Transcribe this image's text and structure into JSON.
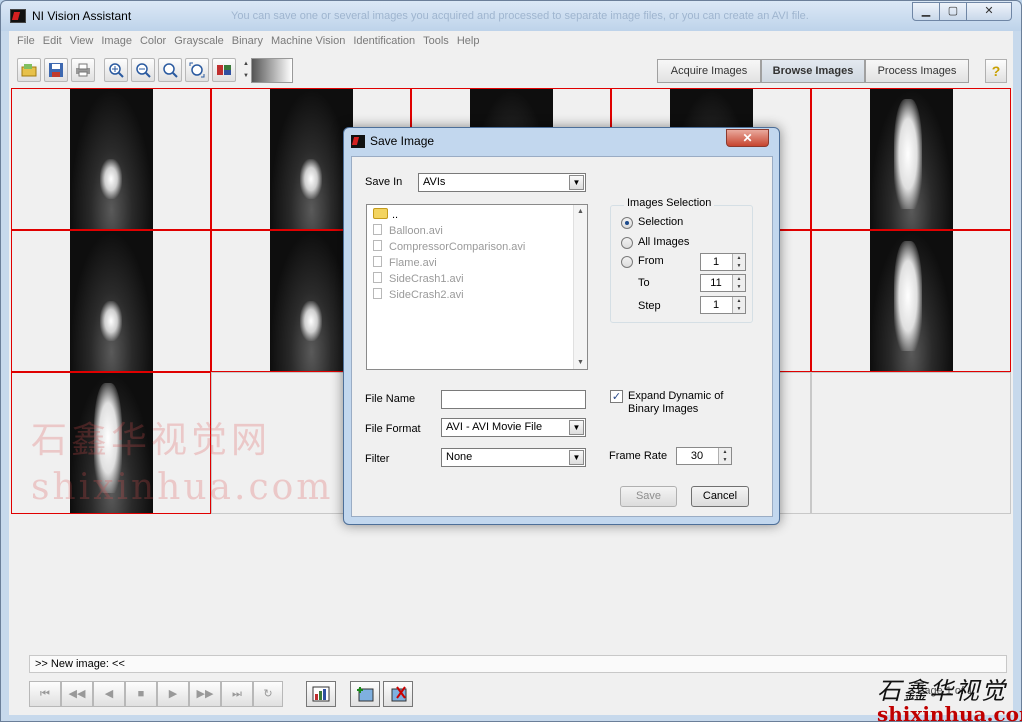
{
  "window": {
    "title": "NI Vision Assistant",
    "ghost_text": "You can save one or several images you acquired and processed to separate image files, or you can create an AVI file."
  },
  "menu": [
    "File",
    "Edit",
    "View",
    "Image",
    "Color",
    "Grayscale",
    "Binary",
    "Machine Vision",
    "Identification",
    "Tools",
    "Help"
  ],
  "mode_tabs": {
    "acquire": "Acquire Images",
    "browse": "Browse Images",
    "process": "Process Images"
  },
  "help_label": "?",
  "status": {
    "log_text": ">> New image:  <<",
    "page_text": "Page 1 of 1"
  },
  "watermark": {
    "cn": "石鑫华视觉网",
    "en": "shixinhua.com"
  },
  "brand": {
    "cn": "石鑫华视觉",
    "en": "shixinhua.com"
  },
  "dialog": {
    "title": "Save Image",
    "close_label": "✕",
    "save_in_label": "Save In",
    "save_in_value": "AVIs",
    "file_list": {
      "parent": "..",
      "files": [
        "Balloon.avi",
        "CompressorComparison.avi",
        "Flame.avi",
        "SideCrash1.avi",
        "SideCrash2.avi"
      ]
    },
    "images_selection": {
      "legend": "Images Selection",
      "option_selection": "Selection",
      "option_all": "All Images",
      "option_from": "From",
      "to_label": "To",
      "step_label": "Step",
      "from_value": "1",
      "to_value": "11",
      "step_value": "1",
      "selected": "selection"
    },
    "file_name_label": "File Name",
    "file_name_value": "",
    "file_format_label": "File Format",
    "file_format_value": "AVI - AVI Movie File",
    "filter_label": "Filter",
    "filter_value": "None",
    "expand_dynamic_label_1": "Expand Dynamic of",
    "expand_dynamic_label_2": "Binary Images",
    "expand_dynamic_checked": true,
    "frame_rate_label": "Frame Rate",
    "frame_rate_value": "30",
    "save_label": "Save",
    "cancel_label": "Cancel"
  },
  "colors": {
    "selection_border": "#e00000",
    "accent": "#1c4a8c"
  }
}
